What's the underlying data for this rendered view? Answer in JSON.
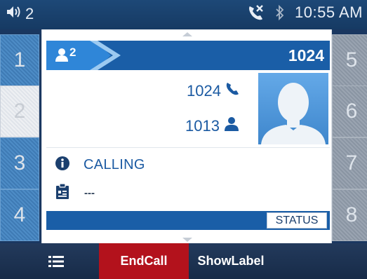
{
  "status_bar": {
    "volume_icon": "speaker-icon",
    "line_indicator": "2",
    "missed_call_icon": "missed-call-icon",
    "bluetooth_icon": "bluetooth-icon",
    "time": "10:55 AM"
  },
  "line_keys": {
    "left": [
      "1",
      "2",
      "3",
      "4"
    ],
    "right": [
      "5",
      "6",
      "7",
      "8"
    ]
  },
  "call": {
    "conference_count": "2",
    "header_number": "1024",
    "rows": [
      {
        "number": "1024",
        "icon": "phone-icon"
      },
      {
        "number": "1013",
        "icon": "person-icon"
      }
    ],
    "avatar_icon": "contact-avatar",
    "state_label": "CALLING",
    "note_value": "---",
    "status_button": "STATUS"
  },
  "softkeys": {
    "menu_icon": "menu-list-icon",
    "end_call": "EndCall",
    "show_label": "ShowLabel"
  },
  "colors": {
    "header_blue": "#1a5ea7",
    "accent_blue": "#1b5aa2",
    "end_call_red": "#b3121c"
  }
}
